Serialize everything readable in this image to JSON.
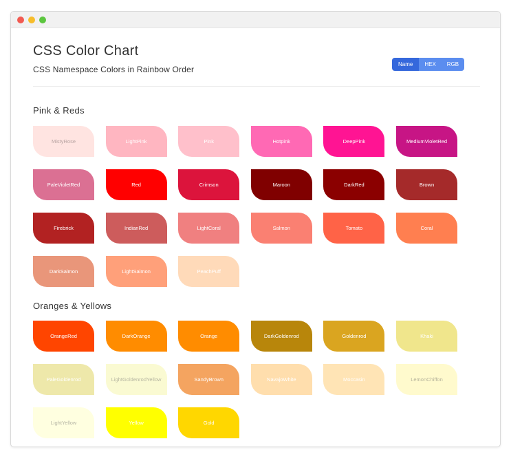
{
  "page": {
    "title": "CSS Color Chart",
    "subtitle": "CSS Namespace Colors in Rainbow Order"
  },
  "toggle": {
    "options": [
      {
        "label": "Name",
        "active": true
      },
      {
        "label": "HEX",
        "active": false
      },
      {
        "label": "RGB",
        "active": false
      }
    ]
  },
  "sections": [
    {
      "heading": "Pink & Reds",
      "swatches": [
        {
          "name": "MistyRose",
          "color": "#ffe4e1",
          "text": "#b8a4a2"
        },
        {
          "name": "LightPink",
          "color": "#ffb6c1",
          "text": "#ffffff"
        },
        {
          "name": "Pink",
          "color": "#ffc0cb",
          "text": "#ffffff"
        },
        {
          "name": "Hotpink",
          "color": "#ff69b4",
          "text": "#ffffff"
        },
        {
          "name": "DeepPink",
          "color": "#ff1493",
          "text": "#ffffff"
        },
        {
          "name": "MediumVioletRed",
          "color": "#c71585",
          "text": "#ffffff"
        },
        {
          "name": "PaleVioletRed",
          "color": "#db7093",
          "text": "#ffffff"
        },
        {
          "name": "Red",
          "color": "#ff0000",
          "text": "#ffffff"
        },
        {
          "name": "Crimson",
          "color": "#dc143c",
          "text": "#ffffff"
        },
        {
          "name": "Maroon",
          "color": "#800000",
          "text": "#ffffff"
        },
        {
          "name": "DarkRed",
          "color": "#8b0000",
          "text": "#ffffff"
        },
        {
          "name": "Brown",
          "color": "#a52a2a",
          "text": "#ffffff"
        },
        {
          "name": "Firebrick",
          "color": "#b22222",
          "text": "#ffffff"
        },
        {
          "name": "IndianRed",
          "color": "#cd5c5c",
          "text": "#ffffff"
        },
        {
          "name": "LightCoral",
          "color": "#f08080",
          "text": "#ffffff"
        },
        {
          "name": "Salmon",
          "color": "#fa8072",
          "text": "#ffffff"
        },
        {
          "name": "Tomato",
          "color": "#ff6347",
          "text": "#ffffff"
        },
        {
          "name": "Coral",
          "color": "#ff7f50",
          "text": "#ffffff"
        },
        {
          "name": "DarkSalmon",
          "color": "#e9967a",
          "text": "#ffffff"
        },
        {
          "name": "LightSalmon",
          "color": "#ffa07a",
          "text": "#ffffff"
        },
        {
          "name": "PeachPuff",
          "color": "#ffdab9",
          "text": "#ffffff"
        }
      ]
    },
    {
      "heading": "Oranges & Yellows",
      "swatches": [
        {
          "name": "OrangeRed",
          "color": "#ff4500",
          "text": "#ffffff"
        },
        {
          "name": "DarkOrange",
          "color": "#ff8c00",
          "text": "#ffffff"
        },
        {
          "name": "Orange",
          "color": "#ff8c00",
          "text": "#ffffff"
        },
        {
          "name": "DarkGoldenrod",
          "color": "#b8860b",
          "text": "#ffffff"
        },
        {
          "name": "Goldenrod",
          "color": "#daa520",
          "text": "#ffffff"
        },
        {
          "name": "Khaki",
          "color": "#f0e68c",
          "text": "#ffffff"
        },
        {
          "name": "PaleGoldenrod",
          "color": "#eee8aa",
          "text": "#ffffff"
        },
        {
          "name": "LightGoldenrodYellow",
          "color": "#fafad2",
          "text": "#b5b5a0"
        },
        {
          "name": "SandyBrown",
          "color": "#f4a460",
          "text": "#ffffff"
        },
        {
          "name": "NavajoWhite",
          "color": "#ffdead",
          "text": "#ffffff"
        },
        {
          "name": "Moccasin",
          "color": "#ffe4b5",
          "text": "#ffffff"
        },
        {
          "name": "LemonChiffon",
          "color": "#fffacd",
          "text": "#b5b29a"
        },
        {
          "name": "LightYellow",
          "color": "#ffffe0",
          "text": "#b5b5a5"
        },
        {
          "name": "Yellow",
          "color": "#ffff00",
          "text": "#ffffff"
        },
        {
          "name": "Gold",
          "color": "#ffd700",
          "text": "#ffffff"
        }
      ]
    }
  ]
}
